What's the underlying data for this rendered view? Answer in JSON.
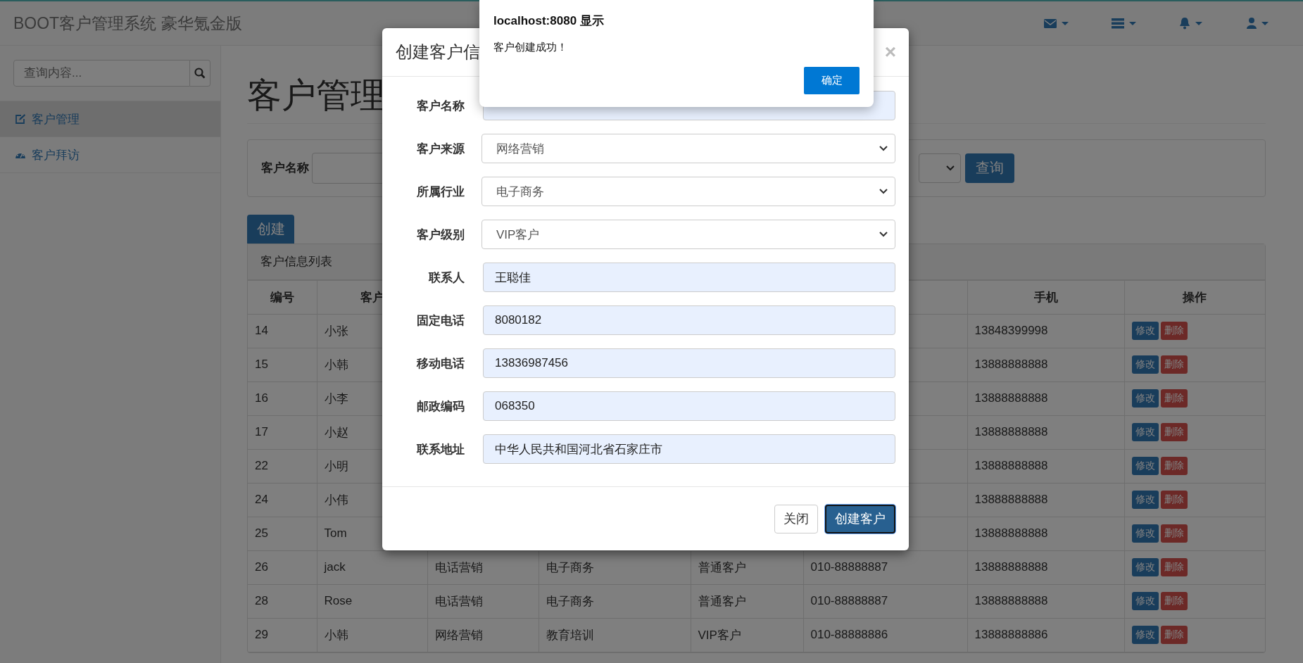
{
  "navbar": {
    "brand": "BOOT客户管理系统 豪华氪金版"
  },
  "sidebar": {
    "search": {
      "placeholder": "查询内容..."
    },
    "items": [
      {
        "label": "客户管理",
        "kind": "edit",
        "selected": true
      },
      {
        "label": "客户拜访",
        "kind": "dashboard",
        "selected": false
      }
    ]
  },
  "page": {
    "heading": "客户管理"
  },
  "filter": {
    "label": "客户名称",
    "button": "查询"
  },
  "create_button": "创建",
  "table": {
    "title": "客户信息列表",
    "columns": [
      "编号",
      "客户",
      null,
      null,
      null,
      null,
      "手机",
      "操作"
    ],
    "rows": [
      {
        "cells": [
          "14",
          "小张",
          null,
          null,
          null,
          null,
          "13848399998"
        ],
        "actions": [
          "修改",
          "删除"
        ]
      },
      {
        "cells": [
          "15",
          "小韩",
          null,
          null,
          null,
          null,
          "13888888888"
        ],
        "actions": [
          "修改",
          "删除"
        ]
      },
      {
        "cells": [
          "16",
          "小李",
          null,
          null,
          null,
          null,
          "13888888888"
        ],
        "actions": [
          "修改",
          "删除"
        ]
      },
      {
        "cells": [
          "17",
          "小赵",
          null,
          null,
          null,
          null,
          "13888888888"
        ],
        "actions": [
          "修改",
          "删除"
        ]
      },
      {
        "cells": [
          "22",
          "小明",
          null,
          null,
          null,
          null,
          "13888888888"
        ],
        "actions": [
          "修改",
          "删除"
        ]
      },
      {
        "cells": [
          "24",
          "小伟",
          null,
          null,
          null,
          null,
          "13888888888"
        ],
        "actions": [
          "修改",
          "删除"
        ]
      },
      {
        "cells": [
          "25",
          "Tom",
          null,
          null,
          null,
          null,
          "13888888888"
        ],
        "actions": [
          "修改",
          "删除"
        ]
      },
      {
        "cells": [
          "26",
          "jack",
          "电话营销",
          "电子商务",
          "普通客户",
          "010-88888887",
          "13888888888"
        ],
        "actions": [
          "修改",
          "删除"
        ]
      },
      {
        "cells": [
          "28",
          "Rose",
          "电话营销",
          "电子商务",
          "普通客户",
          "010-88888887",
          "13888888888"
        ],
        "actions": [
          "修改",
          "删除"
        ]
      },
      {
        "cells": [
          "29",
          "小韩",
          "网络营销",
          "教育培训",
          "VIP客户",
          "010-88888886",
          "13888888886"
        ],
        "actions": [
          "修改",
          "删除"
        ]
      }
    ]
  },
  "modal": {
    "title": "创建客户信",
    "close": "×",
    "fields": [
      {
        "label": "客户名称",
        "kind": "text"
      },
      {
        "label": "客户来源",
        "kind": "select",
        "value": "网络营销"
      },
      {
        "label": "所属行业",
        "kind": "select",
        "value": "电子商务"
      },
      {
        "label": "客户级别",
        "kind": "select",
        "value": "VIP客户"
      },
      {
        "label": "联系人",
        "kind": "text",
        "value": "王聪佳"
      },
      {
        "label": "固定电话",
        "kind": "text",
        "value": "8080182"
      },
      {
        "label": "移动电话",
        "kind": "text",
        "value": "13836987456"
      },
      {
        "label": "邮政编码",
        "kind": "text",
        "value": "068350"
      },
      {
        "label": "联系地址",
        "kind": "text",
        "value": "中华人民共和国河北省石家庄市"
      }
    ],
    "buttons": [
      {
        "label": "关闭",
        "kind": "default"
      },
      {
        "label": "创建客户",
        "kind": "primary"
      }
    ]
  },
  "alert": {
    "title": "localhost:8080 显示",
    "message": "客户创建成功！",
    "button": "确定"
  }
}
